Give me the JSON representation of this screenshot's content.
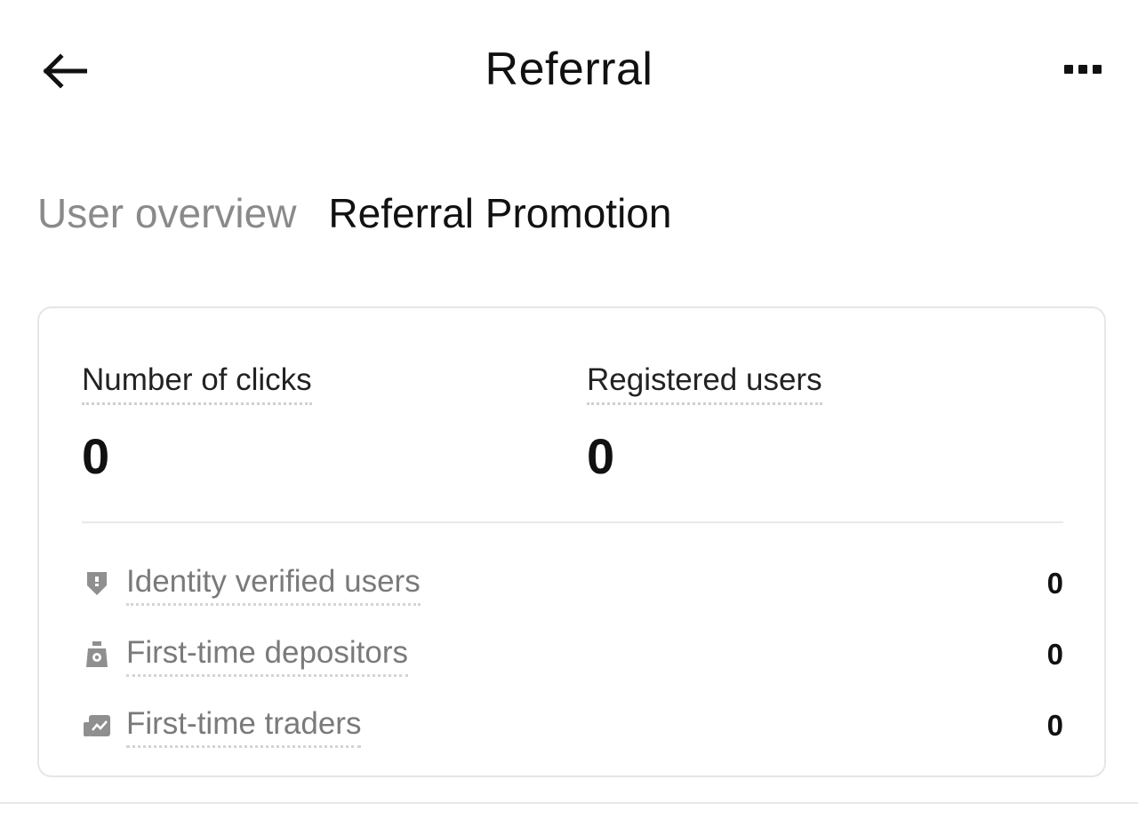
{
  "header": {
    "title": "Referral",
    "back_icon": "arrow-left-icon",
    "more_icon": "more-horizontal-icon"
  },
  "tabs": [
    {
      "label": "User overview",
      "active": false
    },
    {
      "label": "Referral Promotion",
      "active": true
    }
  ],
  "stats": {
    "clicks": {
      "label": "Number of clicks",
      "value": "0"
    },
    "registered": {
      "label": "Registered users",
      "value": "0"
    }
  },
  "rows": [
    {
      "icon": "shield-icon",
      "label": "Identity verified users",
      "value": "0"
    },
    {
      "icon": "money-bag-icon",
      "label": "First-time depositors",
      "value": "0"
    },
    {
      "icon": "chart-trend-icon",
      "label": "First-time traders",
      "value": "0"
    }
  ],
  "colors": {
    "text_primary": "#111111",
    "text_muted": "#8a8a8a",
    "border": "#e6e6e6",
    "icon_gray": "#8f8f8f"
  }
}
